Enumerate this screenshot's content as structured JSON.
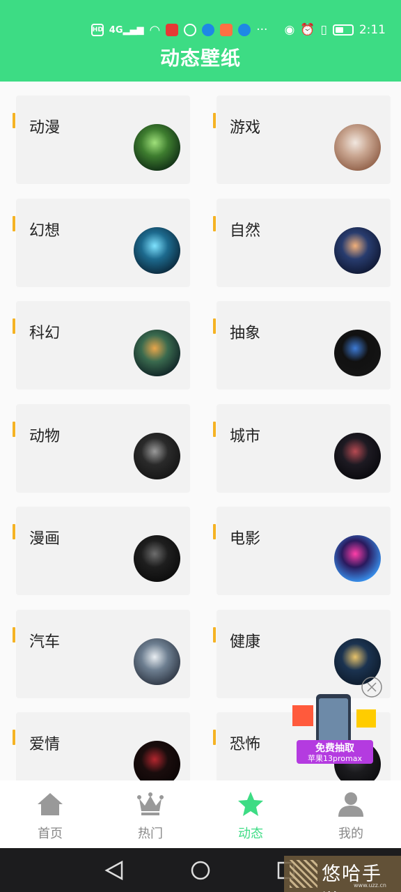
{
  "status_bar": {
    "time": "2:11",
    "network_label": "HD",
    "signal_label": "4G",
    "more": "···",
    "battery_level": 0.5
  },
  "header": {
    "title": "动态壁纸"
  },
  "categories": [
    {
      "label": "动漫",
      "colors": [
        "#3e7d2f",
        "#9fe07a",
        "#0e2a14"
      ]
    },
    {
      "label": "游戏",
      "colors": [
        "#c9a691",
        "#f1e7df",
        "#8e5d45"
      ]
    },
    {
      "label": "幻想",
      "colors": [
        "#1d6a8e",
        "#7fe3ff",
        "#0a2436"
      ]
    },
    {
      "label": "自然",
      "colors": [
        "#283c6e",
        "#f2b07a",
        "#0e1630"
      ]
    },
    {
      "label": "科幻",
      "colors": [
        "#3a6a4e",
        "#e9a64b",
        "#0d1f23"
      ]
    },
    {
      "label": "抽象",
      "colors": [
        "#111111",
        "#3d7bd6",
        "#151515"
      ]
    },
    {
      "label": "动物",
      "colors": [
        "#2a2a2a",
        "#9a9a9a",
        "#141414"
      ]
    },
    {
      "label": "城市",
      "colors": [
        "#1d1a22",
        "#b64a52",
        "#08080c"
      ]
    },
    {
      "label": "漫画",
      "colors": [
        "#1e1e1e",
        "#6d6d6d",
        "#0b0b0b"
      ]
    },
    {
      "label": "电影",
      "colors": [
        "#2a1a5e",
        "#ff3ea8",
        "#3aa0ff"
      ]
    },
    {
      "label": "汽车",
      "colors": [
        "#6d7e90",
        "#e9eef2",
        "#2b3340"
      ]
    },
    {
      "label": "健康",
      "colors": [
        "#1b3350",
        "#e8c36a",
        "#0d1a2a"
      ]
    },
    {
      "label": "爱情",
      "colors": [
        "#1a0d0d",
        "#b3262e",
        "#0b0505"
      ]
    },
    {
      "label": "恐怖",
      "colors": [
        "#1b1b1e",
        "#404048",
        "#0b0b0d"
      ]
    }
  ],
  "promo": {
    "line1": "免费抽取",
    "line2": "苹果13promax"
  },
  "bottom_nav": [
    {
      "label": "首页",
      "icon": "home-icon",
      "active": false
    },
    {
      "label": "热门",
      "icon": "crown-icon",
      "active": false
    },
    {
      "label": "动态",
      "icon": "star-icon",
      "active": true
    },
    {
      "label": "我的",
      "icon": "person-icon",
      "active": false
    }
  ],
  "watermark": {
    "text": "悠哈手游",
    "sub": "www.uzz.cn"
  },
  "colors": {
    "accent": "#3ddc84",
    "label_bar": "#f5b324",
    "inactive": "#888888",
    "icon_gray": "#999999"
  }
}
